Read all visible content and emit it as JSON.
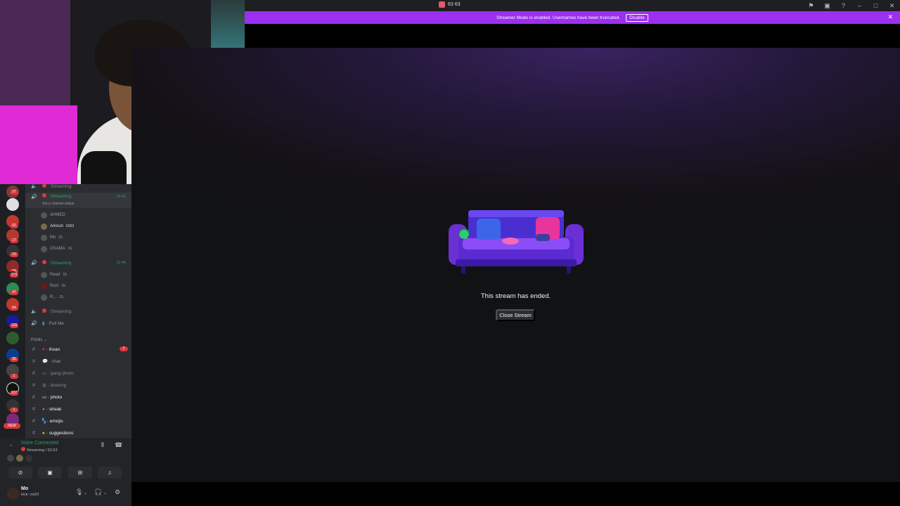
{
  "window": {
    "title": "63 63"
  },
  "banner": {
    "text": "Streamer Mode is enabled. Usernames have been truncated.",
    "disable_label": "Disable"
  },
  "stage": {
    "ended_text": "This stream has ended.",
    "close_label": "Close Stream"
  },
  "channels": {
    "voice": [
      {
        "label": "Streaming",
        "muted": true
      },
      {
        "label": "Streaming",
        "active": true,
        "time": "19:41",
        "status": "Set a channel status",
        "members": [
          {
            "name": "AHMED"
          },
          {
            "name": "Arkoun",
            "tag": "6363"
          },
          {
            "name": "Mo",
            "tag": "OL"
          },
          {
            "name": "OSAMA",
            "tag": "OL"
          }
        ]
      },
      {
        "label": "Streaming",
        "active": true,
        "time": "12:46",
        "members": [
          {
            "name": "Read",
            "tag": "OL"
          },
          {
            "name": "Rust",
            "tag": "OL"
          },
          {
            "name": "R...",
            "tag": "OL"
          }
        ]
      },
      {
        "label": "Streaming"
      },
      {
        "label": "Pull Me"
      }
    ],
    "category": "Public",
    "text": [
      {
        "label": "ihsan",
        "badge": "2",
        "bold": true
      },
      {
        "label": "chat"
      },
      {
        "label": "gang-photo"
      },
      {
        "label": "drawing"
      },
      {
        "label": "photo",
        "bold": true
      },
      {
        "label": "streak",
        "bold": true
      },
      {
        "label": "emojis",
        "bold": true
      },
      {
        "label": "suggestions",
        "bold": true
      }
    ]
  },
  "rail": {
    "badges": [
      "27",
      "62",
      "17",
      "19",
      "23",
      "173",
      "47",
      "64",
      "120",
      "36",
      "1",
      "127",
      "1"
    ],
    "new_label": "NEW"
  },
  "voice_panel": {
    "title": "Voice Connected",
    "subtitle": "Streaming / 63 63"
  },
  "user": {
    "name": "Mo",
    "status": "kick: vxi23"
  },
  "colors": {
    "accent": "#9b30f0",
    "online": "#23a559",
    "danger": "#da373c"
  }
}
